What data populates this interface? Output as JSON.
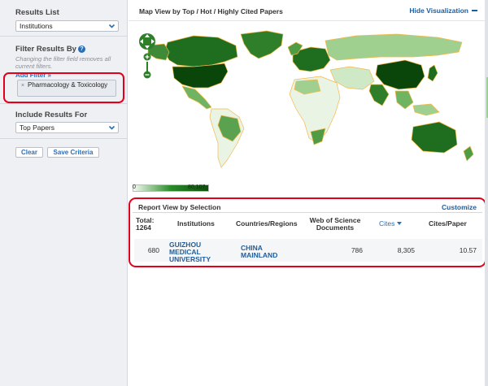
{
  "sidebar": {
    "results_list": {
      "title": "Results List",
      "selected": "Institutions"
    },
    "filter": {
      "title": "Filter Results By",
      "hint": "Changing the filter field removes all current filters.",
      "add_filter": "Add Filter »",
      "chip_remove": "×",
      "chip_label": "Pharmacology & Toxicology"
    },
    "include": {
      "title": "Include Results For",
      "selected": "Top Papers"
    },
    "buttons": {
      "clear": "Clear",
      "save": "Save Criteria"
    },
    "help_icon": "?"
  },
  "map": {
    "title": "Map View by Top / Hot / Highly Cited Papers",
    "hide_label": "Hide Visualization",
    "legend_min": "0",
    "legend_max": "80,107",
    "colors": {
      "lightest": "#e9f4e5",
      "light": "#9fd08f",
      "mid": "#4f9c45",
      "dark": "#1f6d1f",
      "darkest": "#0a450a",
      "border": "#f5b94a"
    }
  },
  "report": {
    "title": "Report View by Selection",
    "customize": "Customize",
    "total_label": "Total:",
    "total_value": "1264",
    "columns": {
      "institutions": "Institutions",
      "countries": "Countries/Regions",
      "wos_line1": "Web of Science",
      "wos_line2": "Documents",
      "cites": "Cites",
      "cites_per_paper": "Cites/Paper"
    },
    "row": {
      "rank": "680",
      "institution_l1": "GUIZHOU",
      "institution_l2": "MEDICAL",
      "institution_l3": "UNIVERSITY",
      "country_l1": "CHINA",
      "country_l2": "MAINLAND",
      "wos": "786",
      "cites": "8,305",
      "cites_per_paper": "10.57"
    }
  },
  "accent": {
    "link": "#2a6fb6",
    "highlight": "#e3001b"
  }
}
